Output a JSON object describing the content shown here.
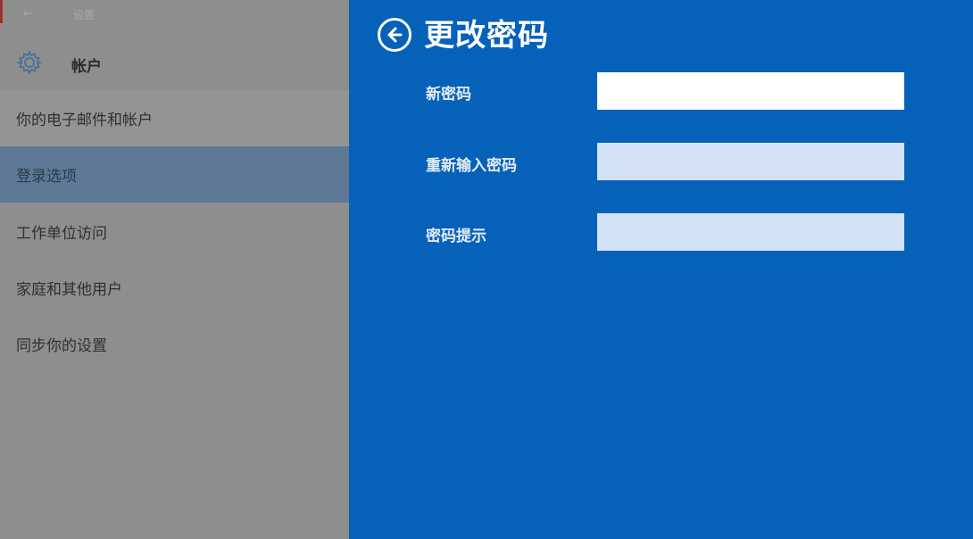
{
  "window": {
    "back_glyph": "←",
    "title": "设置"
  },
  "sidebar": {
    "section_icon": "gear-icon",
    "section_label": "帐户",
    "items": [
      {
        "label": "你的电子邮件和帐户",
        "state": "normal"
      },
      {
        "label": "登录选项",
        "state": "active"
      },
      {
        "label": "工作单位访问",
        "state": "normal"
      },
      {
        "label": "家庭和其他用户",
        "state": "normal"
      },
      {
        "label": "同步你的设置",
        "state": "normal"
      }
    ]
  },
  "dialog": {
    "back_icon": "back-arrow-circle-icon",
    "title": "更改密码",
    "fields": [
      {
        "label": "新密码",
        "value": "",
        "placeholder": ""
      },
      {
        "label": "重新输入密码",
        "value": "",
        "placeholder": ""
      },
      {
        "label": "密码提示",
        "value": "",
        "placeholder": ""
      }
    ]
  },
  "colors": {
    "dialog_bg": "#0661b9",
    "sidebar_bg": "#8e8e8e",
    "active_item_bg": "#5e7896"
  }
}
